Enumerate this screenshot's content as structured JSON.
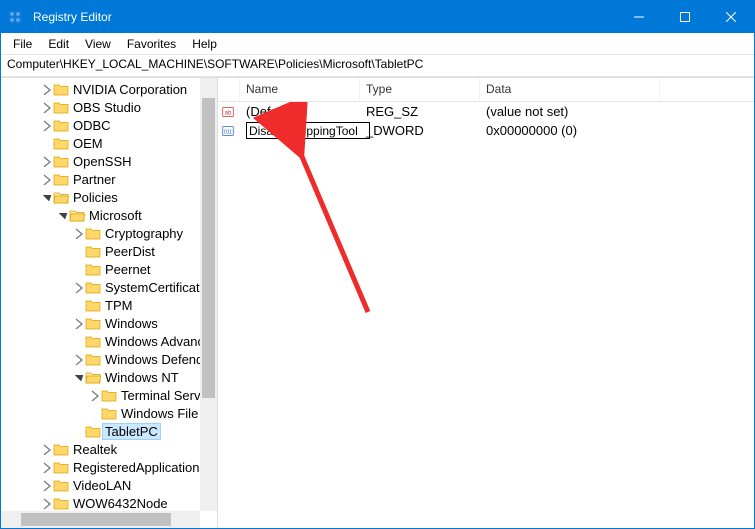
{
  "window": {
    "title": "Registry Editor"
  },
  "menubar": [
    "File",
    "Edit",
    "View",
    "Favorites",
    "Help"
  ],
  "address": "Computer\\HKEY_LOCAL_MACHINE\\SOFTWARE\\Policies\\Microsoft\\TabletPC",
  "tree": [
    {
      "depth": 2,
      "exp": "closed",
      "label": "NVIDIA Corporation"
    },
    {
      "depth": 2,
      "exp": "closed",
      "label": "OBS Studio"
    },
    {
      "depth": 2,
      "exp": "closed",
      "label": "ODBC"
    },
    {
      "depth": 2,
      "exp": "none",
      "label": "OEM"
    },
    {
      "depth": 2,
      "exp": "closed",
      "label": "OpenSSH"
    },
    {
      "depth": 2,
      "exp": "closed",
      "label": "Partner"
    },
    {
      "depth": 2,
      "exp": "open",
      "label": "Policies"
    },
    {
      "depth": 3,
      "exp": "open",
      "label": "Microsoft"
    },
    {
      "depth": 4,
      "exp": "closed",
      "label": "Cryptography"
    },
    {
      "depth": 4,
      "exp": "none",
      "label": "PeerDist"
    },
    {
      "depth": 4,
      "exp": "none",
      "label": "Peernet"
    },
    {
      "depth": 4,
      "exp": "closed",
      "label": "SystemCertificates"
    },
    {
      "depth": 4,
      "exp": "none",
      "label": "TPM"
    },
    {
      "depth": 4,
      "exp": "closed",
      "label": "Windows"
    },
    {
      "depth": 4,
      "exp": "none",
      "label": "Windows Advanced Threat Protection"
    },
    {
      "depth": 4,
      "exp": "closed",
      "label": "Windows Defender"
    },
    {
      "depth": 4,
      "exp": "open",
      "label": "Windows NT"
    },
    {
      "depth": 5,
      "exp": "closed",
      "label": "Terminal Services"
    },
    {
      "depth": 5,
      "exp": "none",
      "label": "Windows File Protection"
    },
    {
      "depth": 4,
      "exp": "none",
      "label": "TabletPC",
      "selected": true
    },
    {
      "depth": 2,
      "exp": "closed",
      "label": "Realtek"
    },
    {
      "depth": 2,
      "exp": "closed",
      "label": "RegisteredApplications"
    },
    {
      "depth": 2,
      "exp": "closed",
      "label": "VideoLAN"
    },
    {
      "depth": 2,
      "exp": "closed",
      "label": "WOW6432Node"
    }
  ],
  "list": {
    "columns": {
      "name": "Name",
      "type": "Type",
      "data": "Data"
    },
    "rows": [
      {
        "icon": "sz",
        "name": "(Default)",
        "type": "REG_SZ",
        "data": "(value not set)",
        "editing": false
      },
      {
        "icon": "dword",
        "name": "DisableSnippingTool",
        "type": "REG_DWORD",
        "data": "0x00000000 (0)",
        "editing": true,
        "partial_type_suffix": "_DWORD"
      }
    ]
  }
}
